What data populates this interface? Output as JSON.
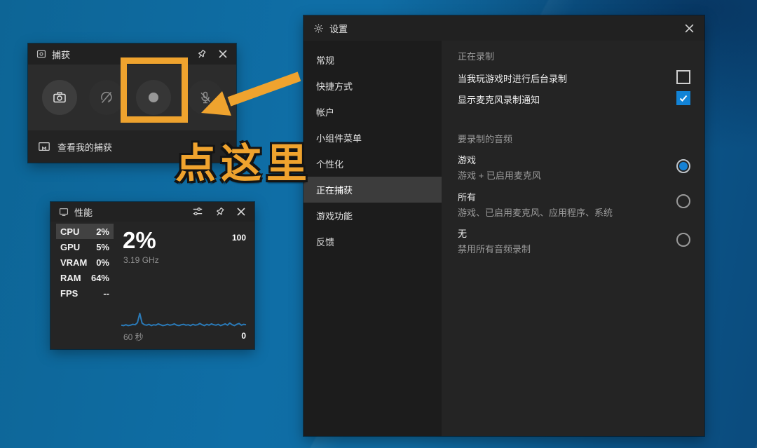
{
  "colors": {
    "annotation_orange": "#EFA32E",
    "accent_blue": "#1283D6",
    "sparkline_blue": "#2A7AB8",
    "desktop_blue": "#0F6EA6"
  },
  "capture_widget": {
    "title": "捕获",
    "buttons": [
      {
        "name": "screenshot"
      },
      {
        "name": "record-last-30-seconds",
        "disabled": true
      },
      {
        "name": "start-recording",
        "highlighted": true
      },
      {
        "name": "microphone-muted",
        "disabled": true
      }
    ],
    "footer_label": "查看我的捕获"
  },
  "performance_widget": {
    "title": "性能",
    "metrics": [
      {
        "label": "CPU",
        "value": "2%",
        "selected": true
      },
      {
        "label": "GPU",
        "value": "5%",
        "selected": false
      },
      {
        "label": "VRAM",
        "value": "0%",
        "selected": false
      },
      {
        "label": "RAM",
        "value": "64%",
        "selected": false
      },
      {
        "label": "FPS",
        "value": "--",
        "selected": false
      }
    ],
    "big_value": "2%",
    "sub_value": "3.19 GHz",
    "y_max": "100",
    "y_min": "0",
    "x_label": "60 秒",
    "sparkline": [
      7,
      6,
      8,
      6,
      7,
      9,
      8,
      13,
      35,
      12,
      8,
      7,
      9,
      6,
      8,
      7,
      10,
      8,
      6,
      7,
      9,
      7,
      8,
      10,
      7,
      6,
      8,
      9,
      7,
      8,
      6,
      9,
      7,
      8,
      11,
      8,
      6,
      9,
      7,
      10,
      8,
      7,
      9,
      6,
      8,
      10,
      7,
      12,
      8,
      6,
      9,
      11,
      7,
      9,
      8
    ]
  },
  "settings_window": {
    "title": "设置",
    "sidebar": [
      {
        "label": "常规",
        "selected": false
      },
      {
        "label": "快捷方式",
        "selected": false
      },
      {
        "label": "帐户",
        "selected": false
      },
      {
        "label": "小组件菜单",
        "selected": false
      },
      {
        "label": "个性化",
        "selected": false
      },
      {
        "label": "正在捕获",
        "selected": true
      },
      {
        "label": "游戏功能",
        "selected": false
      },
      {
        "label": "反馈",
        "selected": false
      }
    ],
    "recording_section": {
      "title": "正在录制",
      "options": [
        {
          "label": "当我玩游戏时进行后台录制",
          "checked": false
        },
        {
          "label": "显示麦克风录制通知",
          "checked": true
        }
      ]
    },
    "audio_section": {
      "title": "要录制的音频",
      "options": [
        {
          "label": "游戏",
          "sub": "游戏 + 已启用麦克风",
          "selected": true
        },
        {
          "label": "所有",
          "sub": "游戏、已启用麦克风、应用程序、系统",
          "selected": false
        },
        {
          "label": "无",
          "sub": "禁用所有音频录制",
          "selected": false
        }
      ]
    }
  },
  "annotation": {
    "text": "点这里"
  }
}
